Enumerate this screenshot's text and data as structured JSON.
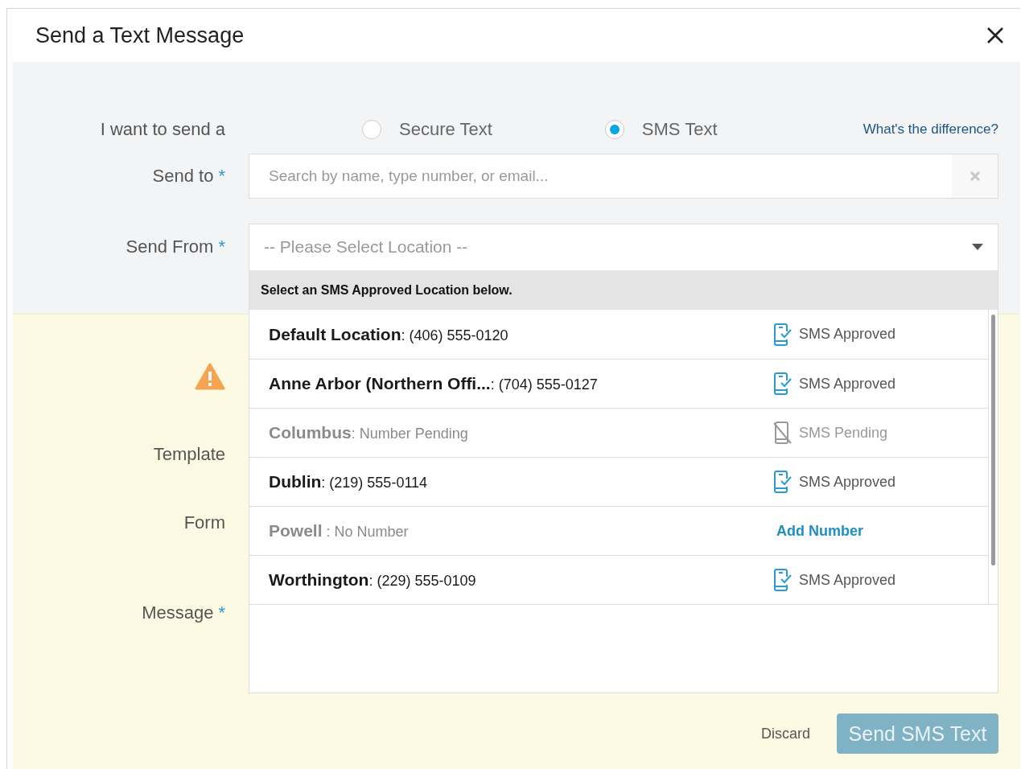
{
  "dialog": {
    "title": "Send a Text Message"
  },
  "message_type": {
    "label": "I want to send a",
    "options": [
      {
        "label": "Secure Text",
        "selected": false
      },
      {
        "label": "SMS Text",
        "selected": true
      }
    ],
    "help_link": "What's the difference?"
  },
  "send_to": {
    "label": "Send to",
    "required_mark": "*",
    "placeholder": "Search by name, type number, or email..."
  },
  "send_from": {
    "label": "Send From",
    "required_mark": "*",
    "placeholder": "-- Please Select Location --",
    "expanded": true,
    "dropdown_header": "Select an SMS Approved Location below.",
    "locations": [
      {
        "name": "Default Location",
        "detail": ": (406) 555-0120",
        "kind": "approved",
        "status": "SMS Approved"
      },
      {
        "name": "Anne Arbor (Northern Offi...",
        "detail": ": (704) 555-0127",
        "kind": "approved",
        "status": "SMS Approved"
      },
      {
        "name": "Columbus",
        "detail": ": Number Pending",
        "kind": "pending",
        "status": "SMS Pending"
      },
      {
        "name": "Dublin",
        "detail": ": (219) 555-0114",
        "kind": "approved",
        "status": "SMS Approved"
      },
      {
        "name": "Powell",
        "detail": " : No Number",
        "kind": "add",
        "status": "Add Number"
      },
      {
        "name": "Worthington",
        "detail": ": (229) 555-0109",
        "kind": "approved",
        "status": "SMS Approved"
      }
    ]
  },
  "template": {
    "label": "Template"
  },
  "form": {
    "label": "Form"
  },
  "message": {
    "label": "Message",
    "required_mark": "*"
  },
  "actions": {
    "discard": "Discard",
    "send": "Send SMS Text",
    "send_disabled": true
  }
}
